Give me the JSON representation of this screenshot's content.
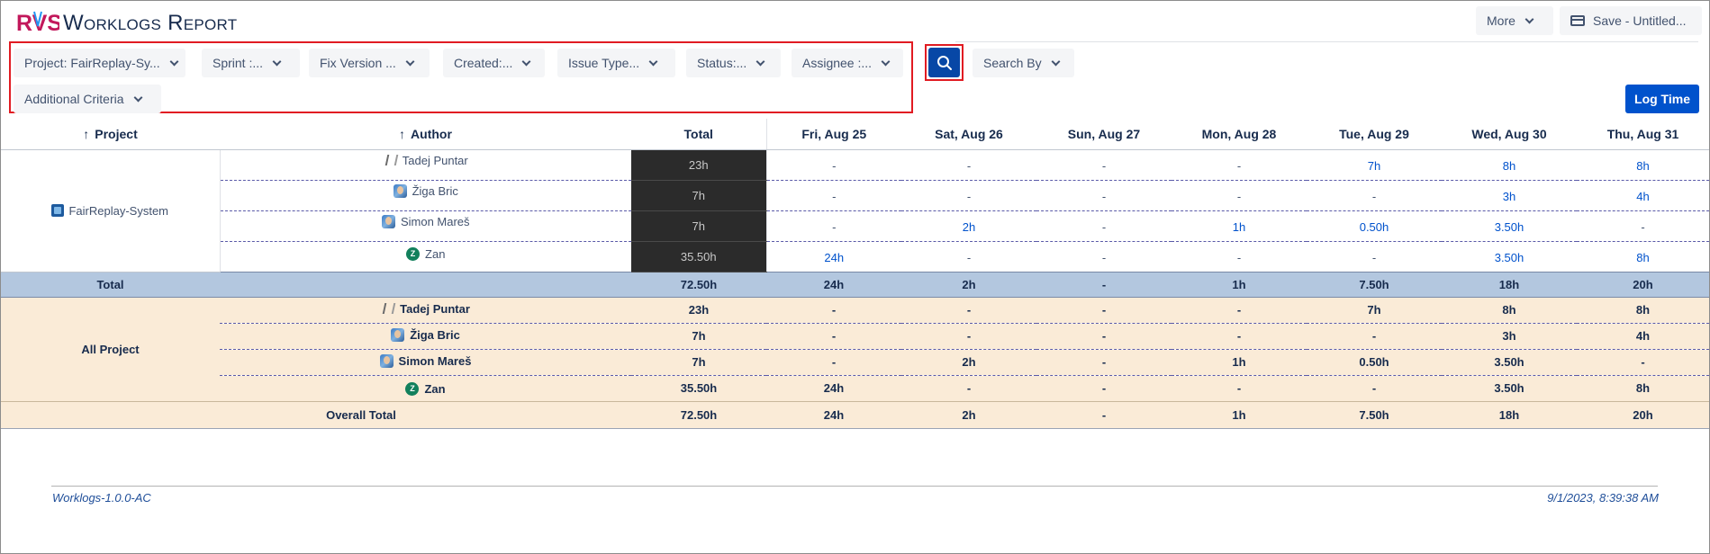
{
  "app": {
    "logo_text": "RVS",
    "title": "Worklogs Report"
  },
  "toolbar": {
    "more_label": "More",
    "save_label": "Save - Untitled..."
  },
  "filters": [
    {
      "label": "Project: FairReplay-Sy..."
    },
    {
      "label": "Sprint :..."
    },
    {
      "label": "Fix Version ..."
    },
    {
      "label": "Created:..."
    },
    {
      "label": "Issue Type..."
    },
    {
      "label": "Status:..."
    },
    {
      "label": "Assignee :..."
    }
  ],
  "additional_criteria_label": "Additional Criteria",
  "search_by_label": "Search By",
  "log_time_label": "Log Time",
  "table": {
    "headers": {
      "project": "Project",
      "author": "Author",
      "total": "Total",
      "days": [
        "Fri, Aug 25",
        "Sat, Aug 26",
        "Sun, Aug 27",
        "Mon, Aug 28",
        "Tue, Aug 29",
        "Wed, Aug 30",
        "Thu, Aug 31"
      ]
    },
    "project_name": "FairReplay-System",
    "rows": [
      {
        "author": "Tadej Puntar",
        "total": "23h",
        "days": [
          "-",
          "-",
          "-",
          "-",
          "7h",
          "8h",
          "8h"
        ]
      },
      {
        "author": "Žiga Bric",
        "total": "7h",
        "days": [
          "-",
          "-",
          "-",
          "-",
          "-",
          "3h",
          "4h"
        ]
      },
      {
        "author": "Simon Mareš",
        "total": "7h",
        "days": [
          "-",
          "2h",
          "-",
          "1h",
          "0.50h",
          "3.50h",
          "-"
        ]
      },
      {
        "author": "Zan",
        "total": "35.50h",
        "days": [
          "24h",
          "-",
          "-",
          "-",
          "-",
          "3.50h",
          "8h"
        ]
      }
    ],
    "project_total": {
      "label": "Total",
      "total": "72.50h",
      "days": [
        "24h",
        "2h",
        "-",
        "1h",
        "7.50h",
        "18h",
        "20h"
      ]
    },
    "all_project_label": "All Project",
    "all_rows": [
      {
        "author": "Tadej Puntar",
        "total": "23h",
        "days": [
          "-",
          "-",
          "-",
          "-",
          "7h",
          "8h",
          "8h"
        ]
      },
      {
        "author": "Žiga Bric",
        "total": "7h",
        "days": [
          "-",
          "-",
          "-",
          "-",
          "-",
          "3h",
          "4h"
        ]
      },
      {
        "author": "Simon Mareš",
        "total": "7h",
        "days": [
          "-",
          "2h",
          "-",
          "1h",
          "0.50h",
          "3.50h",
          "-"
        ]
      },
      {
        "author": "Zan",
        "total": "35.50h",
        "days": [
          "24h",
          "-",
          "-",
          "-",
          "-",
          "3.50h",
          "8h"
        ]
      }
    ],
    "overall_total": {
      "label": "Overall Total",
      "total": "72.50h",
      "days": [
        "24h",
        "2h",
        "-",
        "1h",
        "7.50h",
        "18h",
        "20h"
      ]
    }
  },
  "avatars": [
    "tadej-avatar-icon",
    "photo-avatar-icon",
    "photo-avatar-icon",
    "z-letter-avatar-icon"
  ],
  "zan_initial": "Z",
  "colors": {
    "brand": "#0747a6",
    "primary_button": "#0052cc",
    "highlight_border": "#e11b22",
    "total_row": "#b3c7df",
    "all_project_bg": "#faebd7",
    "dark_total_cell": "#2b2b2b"
  },
  "footer": {
    "version": "Worklogs-1.0.0-AC",
    "timestamp": "9/1/2023, 8:39:38 AM"
  }
}
